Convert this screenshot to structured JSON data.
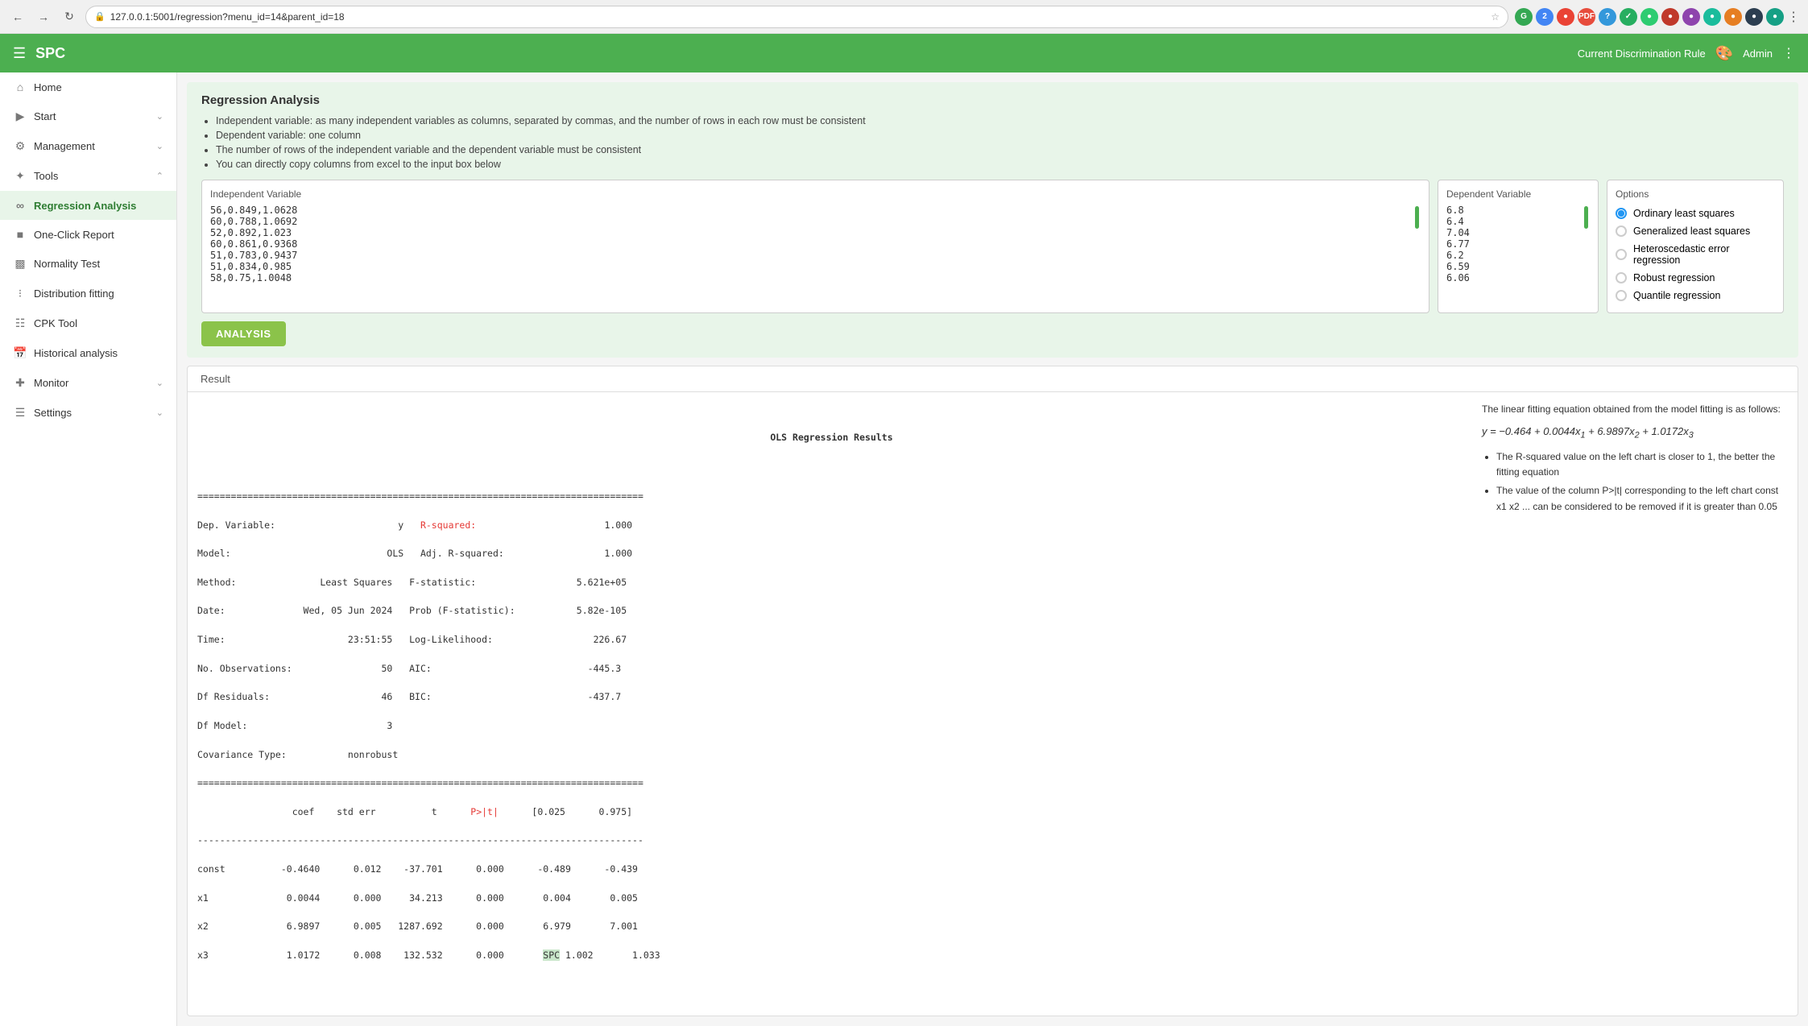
{
  "browser": {
    "url": "127.0.0.1:5001/regression?menu_id=14&parent_id=18",
    "back": "←",
    "forward": "→",
    "reload": "↻"
  },
  "header": {
    "title": "SPC",
    "discrimination_rule": "Current Discrimination Rule",
    "admin": "Admin"
  },
  "sidebar": {
    "home": "Home",
    "start": "Start",
    "management": "Management",
    "tools": "Tools",
    "regression": "Regression Analysis",
    "one_click": "One-Click Report",
    "normality": "Normality Test",
    "distribution": "Distribution fitting",
    "cpk": "CPK Tool",
    "historical": "Historical analysis",
    "monitor": "Monitor",
    "settings": "Settings"
  },
  "page": {
    "title": "Regression Analysis",
    "instructions": [
      "Independent variable: as many independent variables as columns, separated by commas, and the number of rows in each row must be consistent",
      "Dependent variable: one column",
      "The number of rows of the independent variable and the dependent variable must be consistent",
      "You can directly copy columns from excel to the input box below"
    ]
  },
  "independent_variable": {
    "label": "Independent Variable",
    "value": "56,0.849,1.0628\n60,0.788,1.0692\n52,0.892,1.023\n60,0.861,0.9368\n51,0.783,0.9437\n51,0.834,0.985\n58,0.75,1.0048"
  },
  "dependent_variable": {
    "label": "Dependent Variable",
    "value": "6.8\n6.4\n7.04\n6.77\n6.2\n6.59\n6.06"
  },
  "options": {
    "label": "Options",
    "items": [
      {
        "id": "ols",
        "label": "Ordinary least squares",
        "selected": true
      },
      {
        "id": "gls",
        "label": "Generalized least squares",
        "selected": false
      },
      {
        "id": "het",
        "label": "Heteroscedastic error regression",
        "selected": false
      },
      {
        "id": "robust",
        "label": "Robust regression",
        "selected": false
      },
      {
        "id": "quantile",
        "label": "Quantile regression",
        "selected": false
      }
    ]
  },
  "analysis_button": "ANALYSIS",
  "result": {
    "tab": "Result",
    "ols_title": "OLS Regression Results",
    "table": "================================================================================\nDep. Variable:                      y   R-squared:                       1.000\nModel:                            OLS   Adj. R-squared:                  1.000\nMethod:               Least Squares   F-statistic:                  5.621e+05\nDate:              Wed, 05 Jun 2024   Prob (F-statistic):           5.82e-105\nTime:                      23:51:55   Log-Likelihood:                  226.67\nNo. Observations:                50   AIC:                            -445.3\nDf Residuals:                    46   BIC:                            -437.7\nDf Model:                         3\nCovariance Type:           nonrobust\n================================================================================\n                 coef    std err          t      P>|t|      [0.025      0.975]\n--------------------------------------------------------------------------------\nconst          -0.4640      0.012    -37.701      0.000      -0.489      -0.439\nx1              0.0044      0.000     34.213      0.000       0.004       0.005\nx2              6.9897      0.005   1287.692      0.000       6.979       7.001\nx3              1.0172      0.008    132.532      0.000       1.002       1.033",
    "r_squared_label": "R-squared:",
    "r_squared_value": "1.000",
    "p_label": "P>|t|",
    "equation_text": "The linear fitting equation obtained from the model fitting is as follows:",
    "equation": "y = −0.464 + 0.0044x₁ + 6.9897x₂ + 1.0172x₃",
    "notes": [
      "The R-squared value on the left chart is closer to 1, the better the fitting equation",
      "The value of the column P>|t| corresponding to the left chart const x1 x2 ... can be considered to be removed if it is greater than 0.05"
    ]
  }
}
